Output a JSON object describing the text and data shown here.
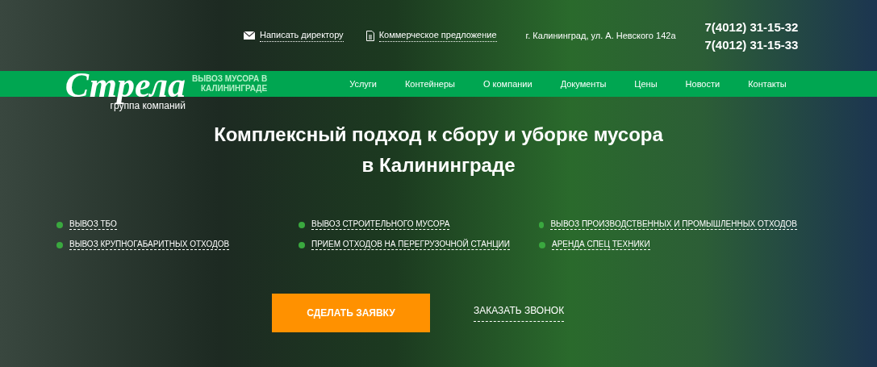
{
  "top_links": [
    {
      "kind": "mail",
      "label": "Написать директору"
    },
    {
      "kind": "document",
      "label": "Коммерческое предложение"
    }
  ],
  "address": "г. Калининград, ул. А. Невского 142а",
  "phones": [
    "7(4012) 31-15-32",
    "7(4012) 31-15-33"
  ],
  "logo": {
    "name": "Стрела",
    "subtitle": "группа компаний"
  },
  "tagline": [
    "ВЫВОЗ МУСОРА В",
    "КАЛИНИНГРАДЕ"
  ],
  "nav": [
    "Услуги",
    "Контейнеры",
    "О компании",
    "Документы",
    "Цены",
    "Новости",
    "Контакты"
  ],
  "headline": "Комплексный подход к сбору и уборке мусора в Калининграде",
  "services": [
    "ВЫВОЗ ТБО",
    "ВЫВОЗ СТРОИТЕЛЬНОГО МУСОРА",
    "ВЫВОЗ ПРОИЗВОДСТВЕННЫХ И ПРОМЫШЛЕННЫХ ОТХОДОВ",
    "ВЫВОЗ КРУПНОГАБАРИТНЫХ ОТХОДОВ",
    "ПРИЕМ ОТХОДОВ НА ПЕРЕГРУЗОЧНОЙ СТАНЦИИ",
    "АРЕНДА СПЕЦ ТЕХНИКИ"
  ],
  "buttons": {
    "primary": "СДЕЛАТЬ ЗАЯВКУ",
    "secondary": "ЗАКАЗАТЬ ЗВОНОК"
  }
}
